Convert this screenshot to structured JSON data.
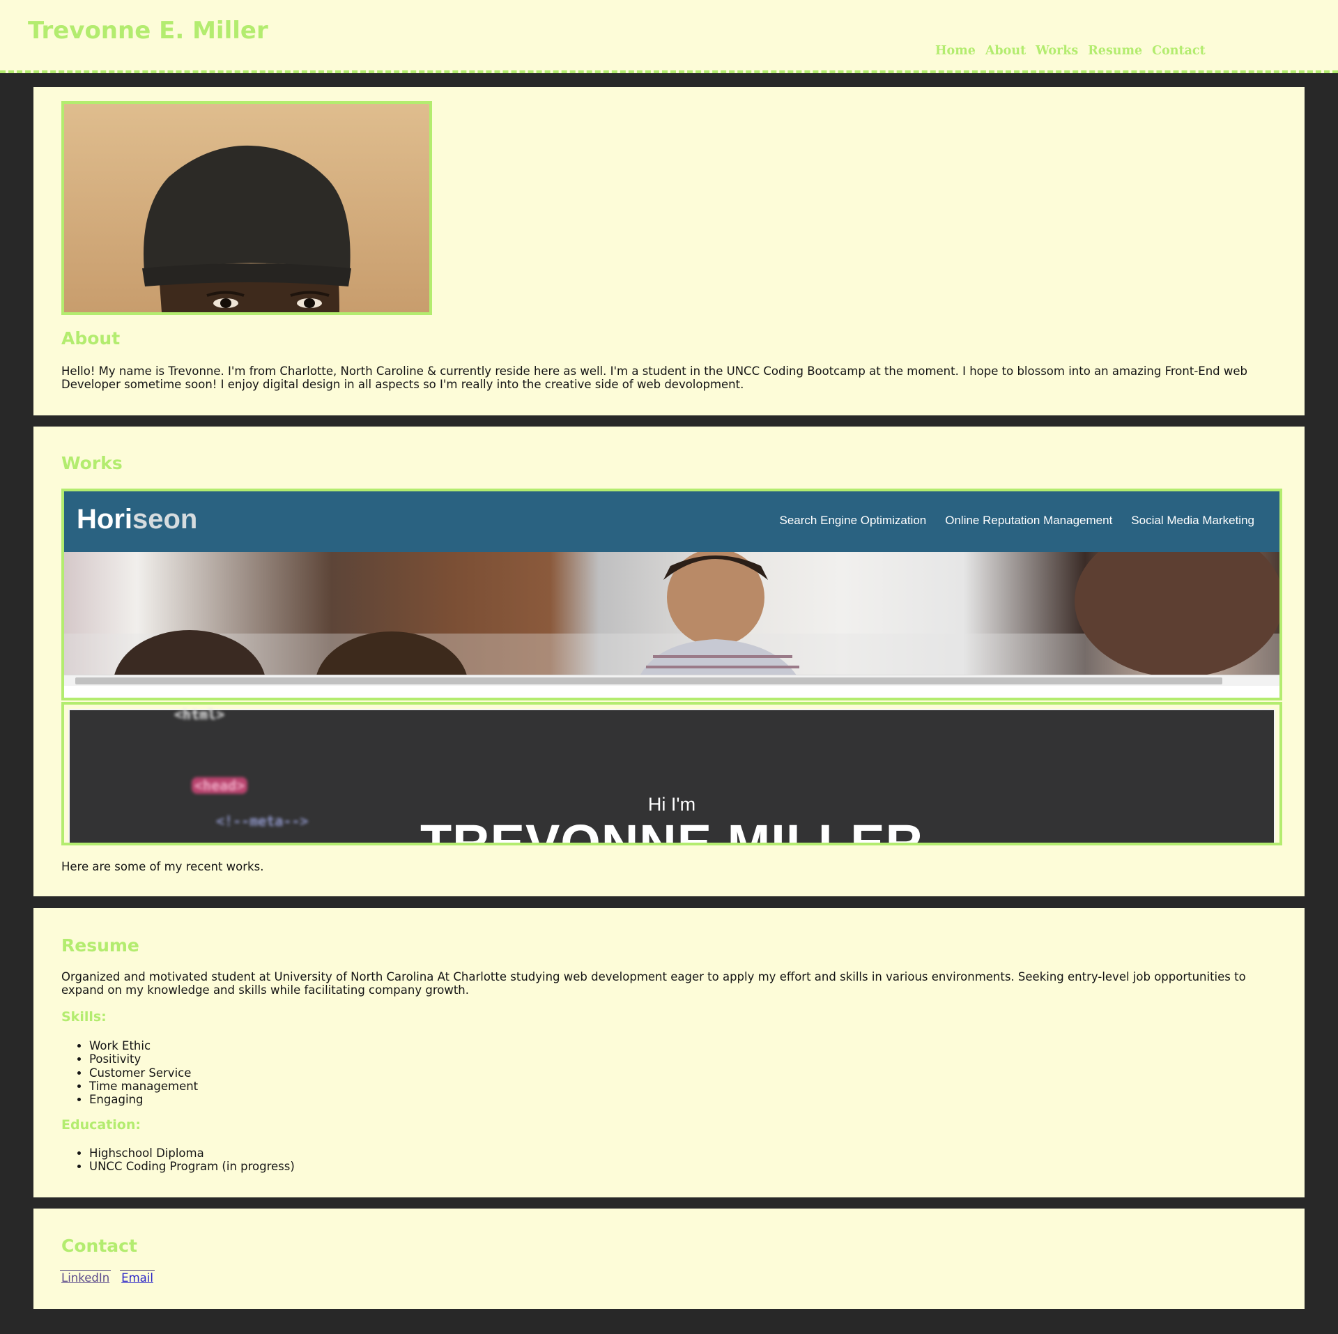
{
  "site": {
    "title": "Trevonne E. Miller",
    "accent_color": "#b3ec6f",
    "panel_color": "#fdfcd8",
    "page_background": "#282828"
  },
  "nav": {
    "items": [
      "Home",
      "About",
      "Works",
      "Resume",
      "Contact"
    ]
  },
  "about": {
    "heading": "About",
    "text": "Hello! My name is Trevonne. I'm from Charlotte, North Caroline & currently reside here as well. I'm a student in the UNCC Coding Bootcamp at the moment. I hope to blossom into an amazing Front-End web Developer sometime soon! I enjoy digital design in all aspects so I'm really into the creative side of web devolopment.",
    "photo_icon": "profile-photo"
  },
  "works": {
    "heading": "Works",
    "caption": "Here are some of my recent works.",
    "horiseon": {
      "logo_primary": "Hori",
      "logo_secondary": "seon",
      "nav": [
        "Search Engine Optimization",
        "Online Reputation Management",
        "Social Media Marketing"
      ],
      "header_color": "#2a6281"
    },
    "portfolio": {
      "greeting": "Hi I'm",
      "name": "TREVONNE MILLER",
      "code_lines": [
        "<html>",
        "<head>",
        "<!--meta-->"
      ]
    }
  },
  "resume": {
    "heading": "Resume",
    "summary": "Organized and motivated student at University of North Carolina At Charlotte studying web development eager to apply my effort and skills in various environments. Seeking entry-level job opportunities to expand on my knowledge and skills while facilitating company growth.",
    "skills_heading": "Skills:",
    "skills": [
      "Work Ethic",
      "Positivity",
      "Customer Service",
      "Time management",
      "Engaging"
    ],
    "education_heading": "Education:",
    "education": [
      "Highschool Diploma",
      "UNCC Coding Program (in progress)"
    ]
  },
  "contact": {
    "heading": "Contact",
    "links": [
      {
        "label": "LinkedIn",
        "color": "#5b4a8c"
      },
      {
        "label": "Email",
        "color": "#2a25c8"
      }
    ]
  }
}
